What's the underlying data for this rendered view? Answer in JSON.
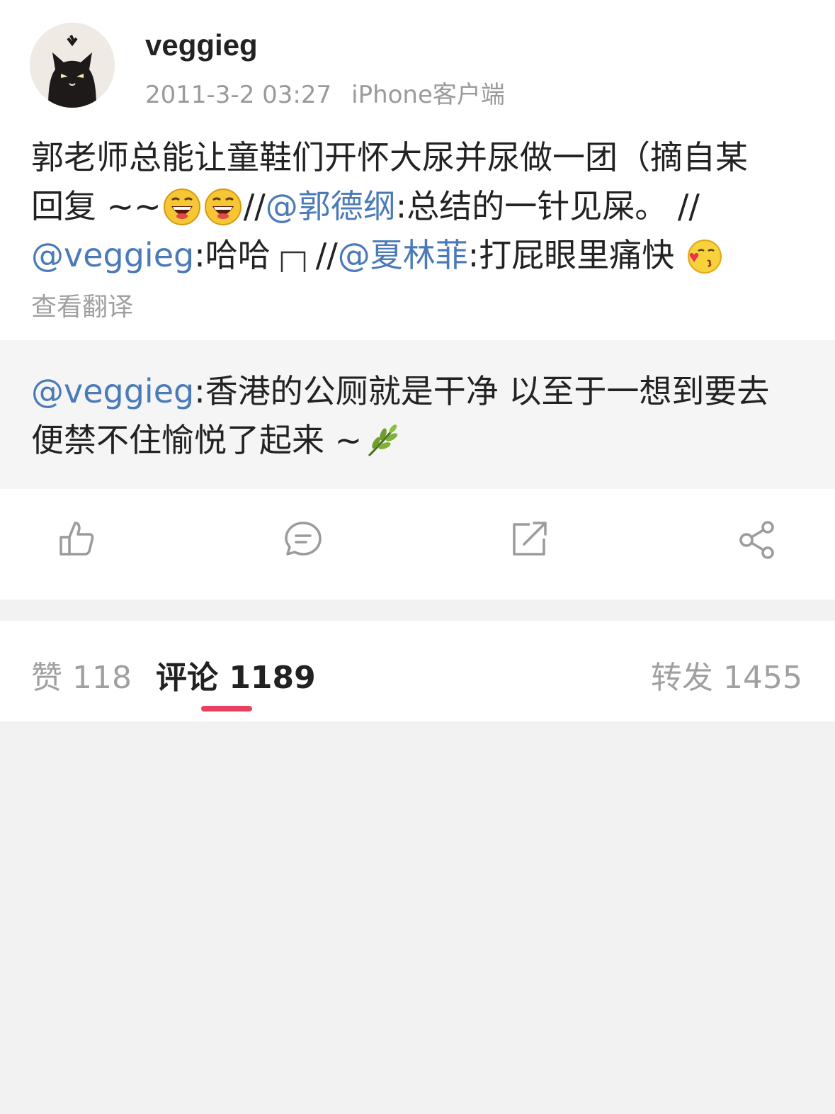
{
  "post": {
    "username": "veggieg",
    "date": "2011-3-2 03:27",
    "source": "iPhone客户端",
    "line1": "郭老师总能让童鞋们开怀大尿并尿做一团（摘自某",
    "line2_a": "回复 ~~",
    "line2_b": " //",
    "mention_1": "@郭德纲",
    "line2_c": ":总结的一针见屎。  //",
    "mention_2": "@veggieg",
    "line3_a": ":哈哈",
    "line3_b": "  //",
    "mention_3": "@夏林菲",
    "line3_c": " :打屁眼里痛快",
    "translate": "查看翻译"
  },
  "quoted": {
    "mention": "@veggieg",
    "line1": ":香港的公厕就是干净 以至于一想到要去",
    "line2": "便禁不住愉悦了起来 ~"
  },
  "actions": {
    "icons": [
      "thumbs-up-icon",
      "comment-icon",
      "repost-icon",
      "share-icon"
    ]
  },
  "tabs": {
    "likes": "赞 118",
    "comments": "评论 1189",
    "reposts": "转发 1455"
  },
  "colors": {
    "mention": "#4a7ab8",
    "accent": "#e8435e"
  }
}
